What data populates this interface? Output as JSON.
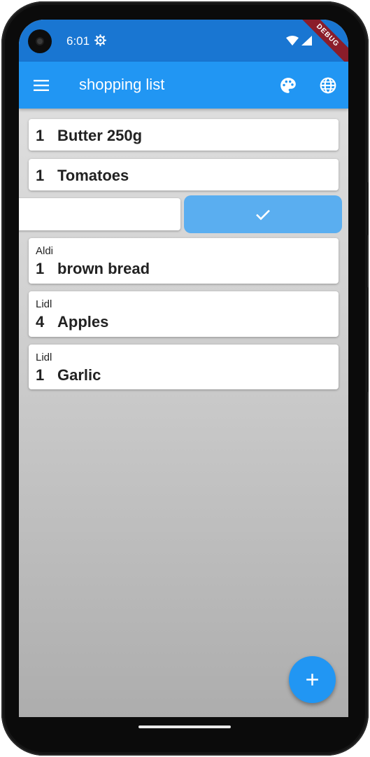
{
  "status_bar": {
    "time": "6:01",
    "debug_banner": "DEBUG"
  },
  "app_bar": {
    "title": "shopping list"
  },
  "items": [
    {
      "store": "",
      "quantity": "1",
      "name": "Butter 250g"
    },
    {
      "store": "",
      "quantity": "1",
      "name": "Tomatoes"
    },
    {
      "store": "Aldi",
      "quantity": "1",
      "name": "brown bread"
    },
    {
      "store": "Lidl",
      "quantity": "4",
      "name": "Apples"
    },
    {
      "store": "Lidl",
      "quantity": "1",
      "name": "Garlic"
    }
  ],
  "icons": {
    "menu": "menu-icon",
    "palette": "palette-icon",
    "language": "globe-icon",
    "swipe_action": "check-icon",
    "fab": "plus-icon"
  },
  "colors": {
    "status_bar": "#1976d2",
    "app_bar": "#2196f3",
    "swipe_action": "#5aaef0",
    "fab": "#2196f3"
  }
}
